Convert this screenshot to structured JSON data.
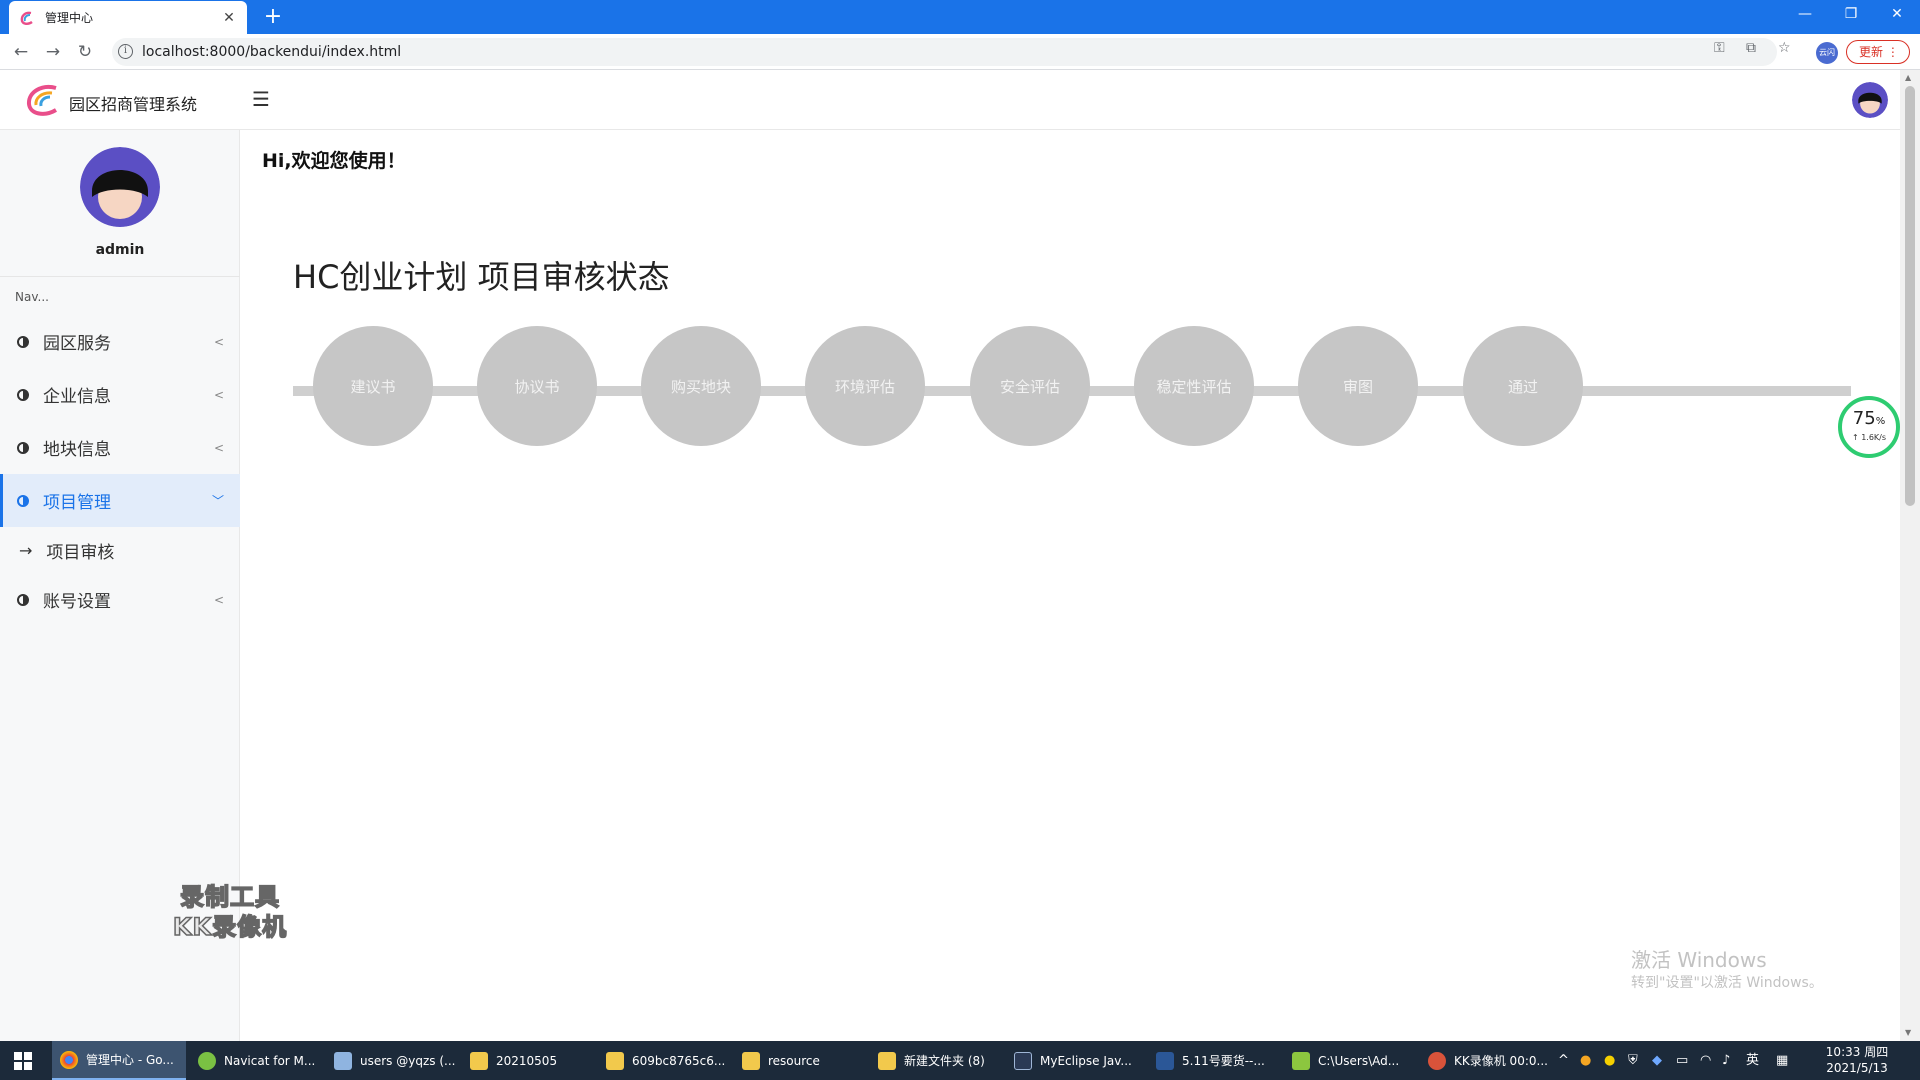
{
  "browser": {
    "tab_title": "管理中心",
    "url": "localhost:8000/backendui/index.html",
    "profile_label": "云闪",
    "update_label": "更新"
  },
  "app": {
    "brand_name": "园区招商管理系统",
    "user_name": "admin",
    "nav_caption": "Nav...",
    "menu": [
      {
        "label": "园区服务"
      },
      {
        "label": "企业信息"
      },
      {
        "label": "地块信息"
      },
      {
        "label": "项目管理",
        "active": true
      },
      {
        "label": "账号设置"
      }
    ],
    "submenu": [
      {
        "label": "项目审核"
      }
    ],
    "welcome": "Hi,欢迎您使用！",
    "status_title": "HC创业计划 项目审核状态",
    "steps": [
      "建议书",
      "协议书",
      "购买地块",
      "环境评估",
      "安全评估",
      "稳定性评估",
      "审图",
      "通过"
    ]
  },
  "recorder_watermark": [
    "录制工具",
    "KK录像机"
  ],
  "speed_widget": {
    "percent": "75",
    "percent_sign": "%",
    "rate": "↑ 1.6K/s"
  },
  "windows_activation": {
    "line1": "激活 Windows",
    "line2": "转到\"设置\"以激活 Windows。"
  },
  "taskbar": {
    "items": [
      {
        "label": "管理中心 - Go...",
        "active": true
      },
      {
        "label": "Navicat for M..."
      },
      {
        "label": "users @yqzs (..."
      },
      {
        "label": "20210505"
      },
      {
        "label": "609bc8765c6..."
      },
      {
        "label": "resource"
      },
      {
        "label": "新建文件夹 (8)"
      },
      {
        "label": "MyEclipse Jav..."
      },
      {
        "label": "5.11号要货--..."
      },
      {
        "label": "C:\\Users\\Ad..."
      },
      {
        "label": "KK录像机 00:0..."
      }
    ],
    "ime": "英",
    "time": "10:33 周四",
    "date": "2021/5/13"
  },
  "colors": {
    "accent": "#1a73e8",
    "step_circle": "#c6c6c6",
    "taskbar": "#1c2a3a",
    "speed_ring": "#2ecc71"
  }
}
